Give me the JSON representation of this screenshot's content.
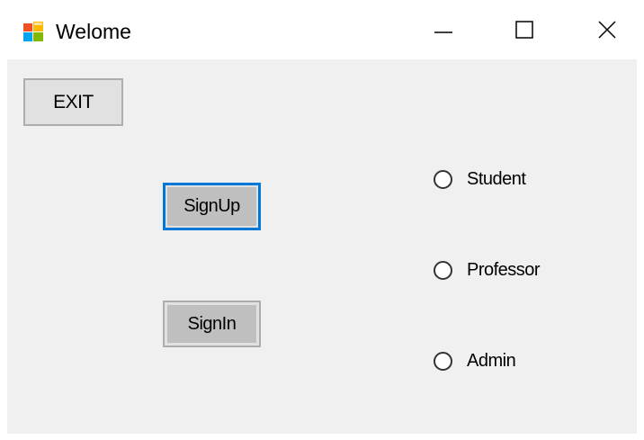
{
  "window": {
    "title": "Welome",
    "controls": {
      "minimize": "minimize-icon",
      "maximize": "maximize-icon",
      "close": "close-icon"
    }
  },
  "buttons": {
    "exit_label": "EXIT",
    "signup_label": "SignUp",
    "signin_label": "SignIn"
  },
  "roles": [
    {
      "label": "Student",
      "selected": false
    },
    {
      "label": "Professor",
      "selected": false
    },
    {
      "label": "Admin",
      "selected": false
    }
  ],
  "colors": {
    "focus_border": "#0078d7",
    "client_background": "#f0f0f0",
    "button_face": "#e1e1e1"
  }
}
